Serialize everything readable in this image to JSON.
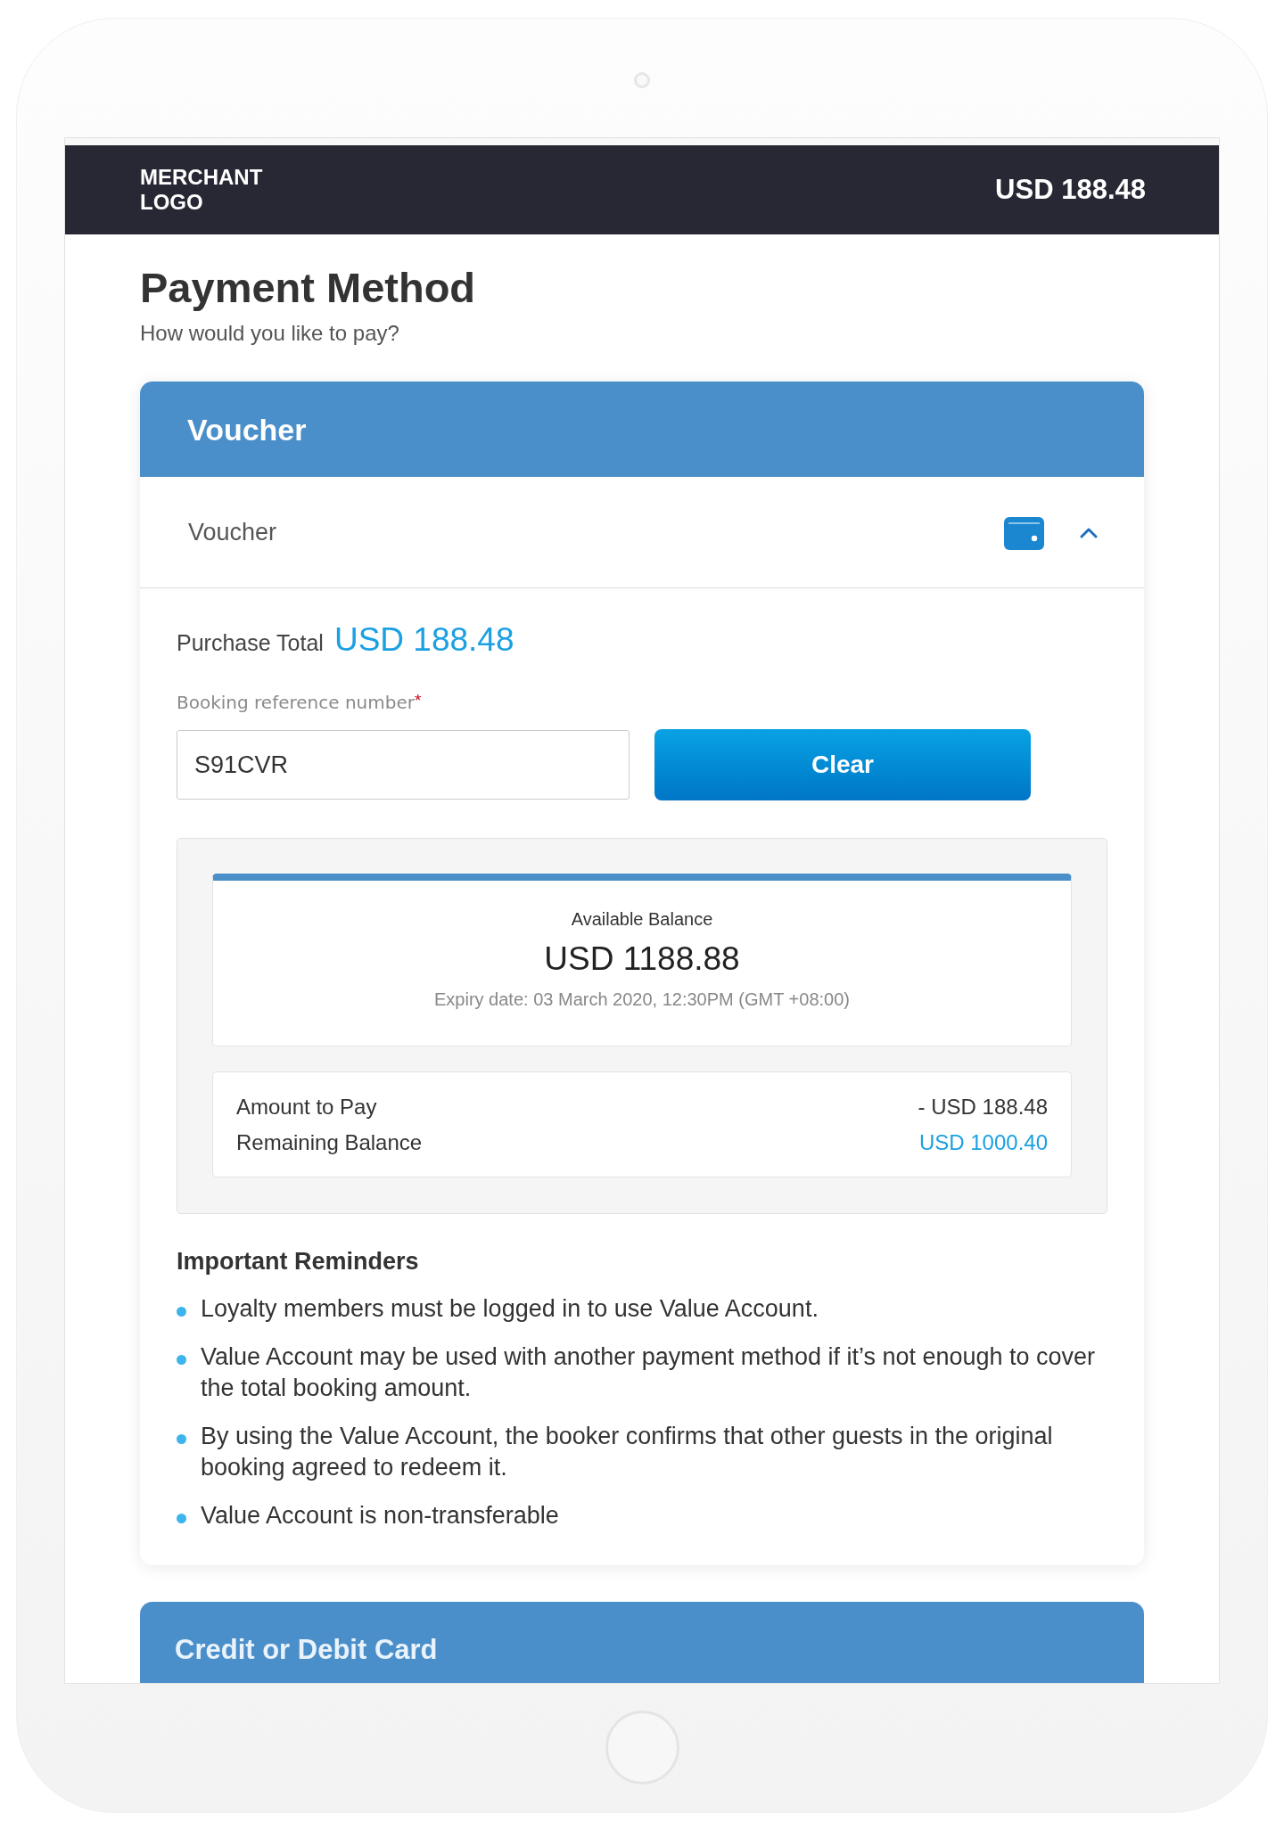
{
  "header": {
    "logo": "MERCHANT LOGO",
    "amount": "USD 188.48"
  },
  "page": {
    "title": "Payment Method",
    "subtitle": "How would you like to pay?"
  },
  "voucher_panel": {
    "title": "Voucher",
    "option": {
      "label": "Voucher",
      "expanded": true
    },
    "purchase_total": {
      "label": "Purchase Total",
      "amount": "USD 188.48"
    },
    "booking_reference": {
      "label": "Booking reference number",
      "required_mark": "*",
      "value": "S91CVR"
    },
    "clear_button": "Clear",
    "balance": {
      "label": "Available Balance",
      "amount": "USD 1188.88",
      "expiry": "Expiry date: 03 March 2020, 12:30PM (GMT +08:00)"
    },
    "summary": [
      {
        "label": "Amount to Pay",
        "value": "- USD 188.48",
        "highlighted": false
      },
      {
        "label": "Remaining Balance",
        "value": "USD 1000.40",
        "highlighted": true
      }
    ],
    "reminders": {
      "title": "Important Reminders",
      "items": [
        "Loyalty members must be logged in to use Value Account.",
        "Value Account may be used with another payment method if it’s not enough to cover the total booking amount.",
        "By using the Value Account, the booker confirms that other guests in the original booking agreed to redeem it.",
        "Value Account is non-transferable"
      ]
    }
  },
  "card_panel": {
    "title": "Credit or Debit Card"
  }
}
